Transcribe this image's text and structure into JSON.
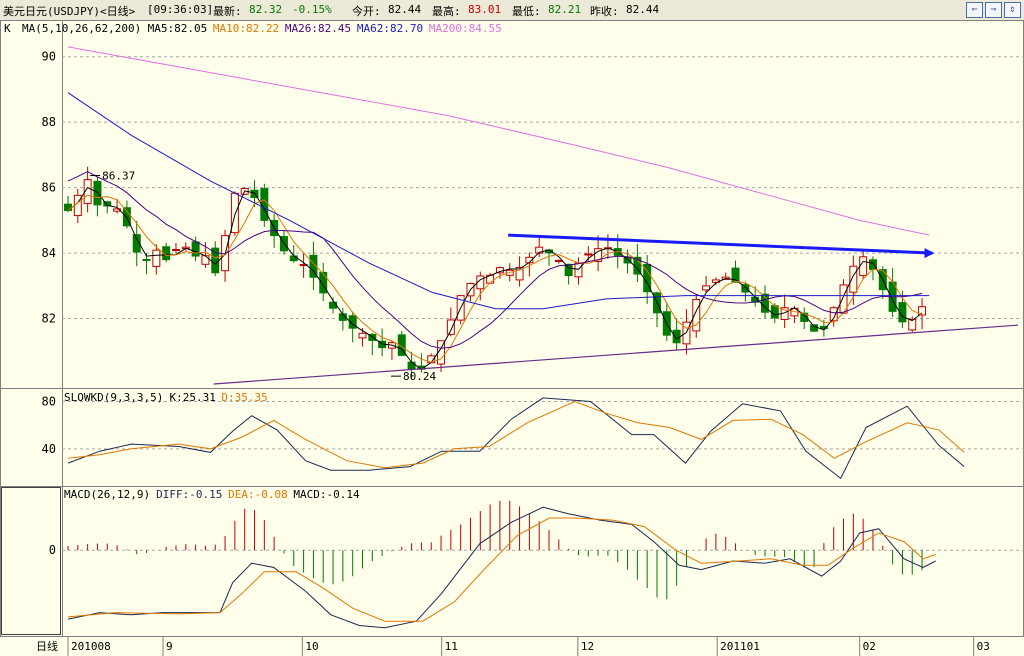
{
  "header": {
    "symbol": "美元日元(USDJPY)<日线>",
    "time": "[09:36:03]",
    "latest_label": "最新:",
    "latest": "82.32",
    "change": "-0.15%",
    "open_label": "今开:",
    "open": "82.44",
    "high_label": "最高:",
    "high": "83.01",
    "low_label": "最低:",
    "low": "82.21",
    "prev_label": "昨收:",
    "prev": "82.44",
    "btn_left": "⇐",
    "btn_mid": "⇒",
    "btn_right": "⇕"
  },
  "colors": {
    "bg": "#ffffec",
    "grid": "#a8a8a8",
    "up": "#c00000",
    "down": "#007a00",
    "ma5": "#000000",
    "ma10": "#e07800",
    "ma26": "#4b0082",
    "ma62": "#1a1acc",
    "ma200": "#e070e0",
    "trend_top": "#1a1aff",
    "trend_bottom": "#6a2a8a",
    "k_line": "#1a2a50",
    "d_line": "#e07800",
    "diff": "#1a2a50",
    "dea": "#e07800"
  },
  "chart_data": [
    {
      "type": "candlestick",
      "title": "K",
      "legend": [
        {
          "text": "MA(5,10,26,62,200)",
          "color": "#000000"
        },
        {
          "text": "MA5:82.05",
          "color": "#000000"
        },
        {
          "text": "MA10:82.22",
          "color": "#e07800"
        },
        {
          "text": "MA26:82.45",
          "color": "#4b0082"
        },
        {
          "text": "MA62:82.70",
          "color": "#1a1acc"
        },
        {
          "text": "MA200:84.55",
          "color": "#e070e0"
        }
      ],
      "ylim": [
        80.0,
        91.0
      ],
      "yticks": [
        90,
        88,
        86,
        84,
        82
      ],
      "annotations": [
        {
          "text": "86.37",
          "x": 7,
          "y": 86.37
        },
        {
          "text": "80.24",
          "x": 102,
          "y": 80.24
        }
      ],
      "trendlines": [
        {
          "name": "resistance",
          "points": [
            [
              139,
              84.55
            ],
            [
              273,
              84.0
            ]
          ]
        },
        {
          "name": "support",
          "points": [
            [
              46,
              80.0
            ],
            [
              300,
              81.8
            ]
          ]
        }
      ],
      "close_path": [
        [
          0,
          85.3
        ],
        [
          4,
          85.9
        ],
        [
          7,
          86.37
        ],
        [
          10,
          85.2
        ],
        [
          14,
          85.6
        ],
        [
          17,
          85.1
        ],
        [
          20,
          84.6
        ],
        [
          23,
          83.6
        ],
        [
          28,
          84.1
        ],
        [
          31,
          83.8
        ],
        [
          36,
          84.3
        ],
        [
          40,
          83.9
        ],
        [
          43,
          84.0
        ],
        [
          45,
          83.6
        ],
        [
          48,
          83.2
        ],
        [
          51,
          85.7
        ],
        [
          55,
          86.0
        ],
        [
          58,
          85.9
        ],
        [
          62,
          85.0
        ],
        [
          66,
          84.4
        ],
        [
          70,
          83.8
        ],
        [
          74,
          83.7
        ],
        [
          78,
          83.2
        ],
        [
          83,
          82.4
        ],
        [
          88,
          81.8
        ],
        [
          94,
          81.5
        ],
        [
          99,
          81.1
        ],
        [
          102,
          81.3
        ],
        [
          106,
          80.8
        ],
        [
          110,
          80.24
        ],
        [
          115,
          80.9
        ],
        [
          119,
          81.5
        ],
        [
          124,
          82.7
        ],
        [
          129,
          83.3
        ],
        [
          133,
          83.3
        ],
        [
          137,
          83.6
        ],
        [
          141,
          83.4
        ],
        [
          145,
          83.8
        ],
        [
          149,
          84.2
        ],
        [
          152,
          84.0
        ],
        [
          156,
          83.7
        ],
        [
          158,
          83.3
        ],
        [
          162,
          83.8
        ],
        [
          166,
          84.1
        ],
        [
          170,
          84.2
        ],
        [
          174,
          83.9
        ],
        [
          178,
          83.6
        ],
        [
          181,
          83.2
        ],
        [
          185,
          82.4
        ],
        [
          189,
          81.5
        ],
        [
          193,
          81.2
        ],
        [
          196,
          82.1
        ],
        [
          200,
          82.9
        ],
        [
          203,
          83.1
        ],
        [
          207,
          83.3
        ],
        [
          211,
          83.1
        ],
        [
          215,
          82.7
        ],
        [
          220,
          82.2
        ],
        [
          223,
          82.0
        ],
        [
          228,
          82.5
        ],
        [
          231,
          82.1
        ],
        [
          235,
          81.6
        ],
        [
          239,
          81.7
        ],
        [
          243,
          82.6
        ],
        [
          247,
          83.5
        ],
        [
          251,
          83.9
        ],
        [
          255,
          83.4
        ],
        [
          259,
          82.5
        ],
        [
          262,
          81.9
        ],
        [
          266,
          81.9
        ],
        [
          270,
          82.4
        ]
      ],
      "ma_note": "MA lines are drawn as smoothed moving averages of the candles"
    },
    {
      "type": "line",
      "title": "SLOWKD(9,3,3,5)",
      "legend": [
        {
          "text": "SLOWKD(9,3,3,5)",
          "color": "#000000"
        },
        {
          "text": "K:25.31",
          "color": "#000000"
        },
        {
          "text": "D:35.35",
          "color": "#e07800"
        }
      ],
      "ylim": [
        12,
        88
      ],
      "yticks": [
        80,
        40
      ],
      "series": [
        {
          "name": "K",
          "values": [
            [
              0,
              28
            ],
            [
              10,
              38
            ],
            [
              20,
              44
            ],
            [
              35,
              42
            ],
            [
              45,
              37
            ],
            [
              52,
              55
            ],
            [
              58,
              68
            ],
            [
              66,
              56
            ],
            [
              75,
              30
            ],
            [
              83,
              22
            ],
            [
              95,
              22
            ],
            [
              108,
              25
            ],
            [
              118,
              38
            ],
            [
              130,
              38
            ],
            [
              140,
              65
            ],
            [
              150,
              83
            ],
            [
              165,
              80
            ],
            [
              178,
              52
            ],
            [
              185,
              52
            ],
            [
              195,
              28
            ],
            [
              203,
              55
            ],
            [
              213,
              78
            ],
            [
              225,
              72
            ],
            [
              233,
              38
            ],
            [
              244,
              15
            ],
            [
              252,
              58
            ],
            [
              265,
              76
            ],
            [
              275,
              43
            ],
            [
              283,
              25
            ]
          ]
        },
        {
          "name": "D",
          "values": [
            [
              0,
              32
            ],
            [
              10,
              35
            ],
            [
              20,
              40
            ],
            [
              35,
              44
            ],
            [
              45,
              40
            ],
            [
              55,
              50
            ],
            [
              65,
              64
            ],
            [
              75,
              48
            ],
            [
              88,
              30
            ],
            [
              100,
              24
            ],
            [
              112,
              28
            ],
            [
              122,
              40
            ],
            [
              133,
              42
            ],
            [
              145,
              62
            ],
            [
              160,
              80
            ],
            [
              170,
              70
            ],
            [
              180,
              62
            ],
            [
              190,
              58
            ],
            [
              200,
              48
            ],
            [
              210,
              64
            ],
            [
              222,
              65
            ],
            [
              232,
              52
            ],
            [
              242,
              32
            ],
            [
              252,
              46
            ],
            [
              265,
              62
            ],
            [
              275,
              56
            ],
            [
              283,
              37
            ]
          ]
        }
      ]
    },
    {
      "type": "bar",
      "title": "MACD(26,12,9)",
      "legend": [
        {
          "text": "MACD(26,12,9)",
          "color": "#000000"
        },
        {
          "text": "DIFF:-0.15",
          "color": "#1a2a50"
        },
        {
          "text": "DEA:-0.08",
          "color": "#e07800"
        },
        {
          "text": "MACD:-0.14",
          "color": "#000000"
        }
      ],
      "ylim": [
        -1.9,
        1.4
      ],
      "yticks": [
        0
      ],
      "bars": [
        [
          0,
          0.1
        ],
        [
          7,
          0.15
        ],
        [
          12,
          0.16
        ],
        [
          17,
          0.1
        ],
        [
          21,
          -0.1
        ],
        [
          26,
          -0.05
        ],
        [
          31,
          0.08
        ],
        [
          38,
          0.15
        ],
        [
          44,
          0.1
        ],
        [
          48,
          0.15
        ],
        [
          52,
          0.6
        ],
        [
          55,
          0.95
        ],
        [
          58,
          1.0
        ],
        [
          62,
          0.7
        ],
        [
          66,
          0.2
        ],
        [
          70,
          -0.3
        ],
        [
          75,
          -0.55
        ],
        [
          80,
          -0.75
        ],
        [
          85,
          -0.8
        ],
        [
          90,
          -0.6
        ],
        [
          95,
          -0.3
        ],
        [
          100,
          -0.1
        ],
        [
          106,
          0.1
        ],
        [
          110,
          0.2
        ],
        [
          114,
          0.15
        ],
        [
          118,
          0.35
        ],
        [
          124,
          0.6
        ],
        [
          130,
          0.9
        ],
        [
          135,
          1.15
        ],
        [
          140,
          1.15
        ],
        [
          145,
          0.9
        ],
        [
          150,
          0.6
        ],
        [
          155,
          0.25
        ],
        [
          160,
          -0.1
        ],
        [
          165,
          -0.15
        ],
        [
          170,
          -0.1
        ],
        [
          176,
          -0.4
        ],
        [
          180,
          -0.7
        ],
        [
          184,
          -0.95
        ],
        [
          188,
          -1.25
        ],
        [
          192,
          -0.85
        ],
        [
          196,
          -0.3
        ],
        [
          200,
          0.2
        ],
        [
          204,
          0.4
        ],
        [
          208,
          0.3
        ],
        [
          212,
          0.1
        ],
        [
          216,
          -0.1
        ],
        [
          221,
          -0.15
        ],
        [
          226,
          -0.15
        ],
        [
          230,
          -0.3
        ],
        [
          235,
          -0.5
        ],
        [
          240,
          0.4
        ],
        [
          244,
          0.7
        ],
        [
          248,
          0.85
        ],
        [
          252,
          0.7
        ],
        [
          256,
          0.3
        ],
        [
          260,
          -0.3
        ],
        [
          264,
          -0.6
        ],
        [
          268,
          -0.55
        ],
        [
          272,
          -0.35
        ]
      ],
      "series": [
        {
          "name": "DIFF",
          "values": [
            [
              0,
              -1.6
            ],
            [
              10,
              -1.45
            ],
            [
              20,
              -1.5
            ],
            [
              30,
              -1.45
            ],
            [
              40,
              -1.45
            ],
            [
              48,
              -1.45
            ],
            [
              52,
              -0.75
            ],
            [
              58,
              -0.3
            ],
            [
              65,
              -0.4
            ],
            [
              75,
              -0.95
            ],
            [
              83,
              -1.5
            ],
            [
              92,
              -1.75
            ],
            [
              100,
              -1.8
            ],
            [
              110,
              -1.65
            ],
            [
              118,
              -1.0
            ],
            [
              130,
              0.15
            ],
            [
              140,
              0.65
            ],
            [
              150,
              1.0
            ],
            [
              158,
              0.85
            ],
            [
              168,
              0.7
            ],
            [
              178,
              0.6
            ],
            [
              185,
              0.2
            ],
            [
              193,
              -0.35
            ],
            [
              200,
              -0.45
            ],
            [
              210,
              -0.25
            ],
            [
              220,
              -0.3
            ],
            [
              228,
              -0.2
            ],
            [
              238,
              -0.6
            ],
            [
              244,
              -0.25
            ],
            [
              250,
              0.4
            ],
            [
              256,
              0.5
            ],
            [
              264,
              -0.2
            ],
            [
              270,
              -0.4
            ],
            [
              274,
              -0.25
            ]
          ]
        },
        {
          "name": "DEA",
          "values": [
            [
              0,
              -1.55
            ],
            [
              15,
              -1.45
            ],
            [
              35,
              -1.48
            ],
            [
              48,
              -1.45
            ],
            [
              55,
              -1.0
            ],
            [
              62,
              -0.5
            ],
            [
              72,
              -0.5
            ],
            [
              80,
              -0.85
            ],
            [
              90,
              -1.35
            ],
            [
              100,
              -1.65
            ],
            [
              112,
              -1.65
            ],
            [
              122,
              -1.2
            ],
            [
              132,
              -0.4
            ],
            [
              142,
              0.35
            ],
            [
              152,
              0.75
            ],
            [
              160,
              0.75
            ],
            [
              172,
              0.7
            ],
            [
              182,
              0.55
            ],
            [
              192,
              0.0
            ],
            [
              200,
              -0.3
            ],
            [
              212,
              -0.25
            ],
            [
              222,
              -0.2
            ],
            [
              232,
              -0.35
            ],
            [
              240,
              -0.35
            ],
            [
              248,
              0.05
            ],
            [
              256,
              0.4
            ],
            [
              264,
              0.2
            ],
            [
              270,
              -0.2
            ],
            [
              274,
              -0.1
            ]
          ]
        }
      ]
    }
  ],
  "xaxis": {
    "left_label": "日线",
    "labels": [
      {
        "text": "201008",
        "x": 0
      },
      {
        "text": "9",
        "x": 30
      },
      {
        "text": "10",
        "x": 74
      },
      {
        "text": "11",
        "x": 118
      },
      {
        "text": "12",
        "x": 161
      },
      {
        "text": "201101",
        "x": 205
      },
      {
        "text": "02",
        "x": 250
      },
      {
        "text": "03",
        "x": 286
      }
    ]
  }
}
